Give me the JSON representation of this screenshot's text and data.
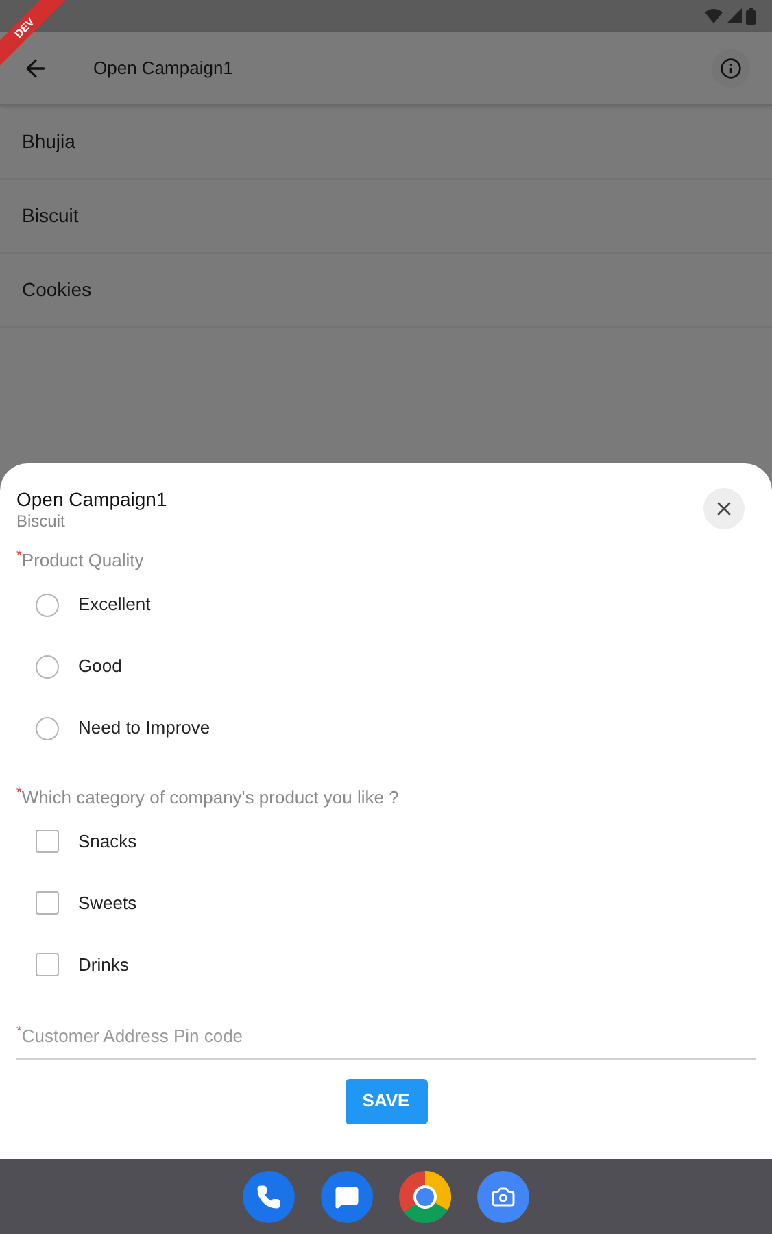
{
  "banner": {
    "label": "DEV"
  },
  "app_bar": {
    "title": "Open Campaign1"
  },
  "list": [
    {
      "label": "Bhujia"
    },
    {
      "label": "Biscuit"
    },
    {
      "label": "Cookies"
    }
  ],
  "sheet": {
    "title": "Open Campaign1",
    "subtitle": "Biscuit",
    "questions": [
      {
        "kind": "radio",
        "required_mark": "*",
        "label": "Product Quality",
        "options": [
          {
            "label": "Excellent",
            "selected": false
          },
          {
            "label": "Good",
            "selected": false
          },
          {
            "label": "Need to Improve",
            "selected": false
          }
        ]
      },
      {
        "kind": "checkbox",
        "required_mark": "*",
        "label": "Which category of company's product  you like ?",
        "options": [
          {
            "label": "Snacks",
            "checked": false
          },
          {
            "label": "Sweets",
            "checked": false
          },
          {
            "label": "Drinks",
            "checked": false
          }
        ]
      },
      {
        "kind": "text",
        "required_mark": "*",
        "placeholder": "Customer Address Pin code"
      }
    ],
    "save_button": "SAVE"
  }
}
